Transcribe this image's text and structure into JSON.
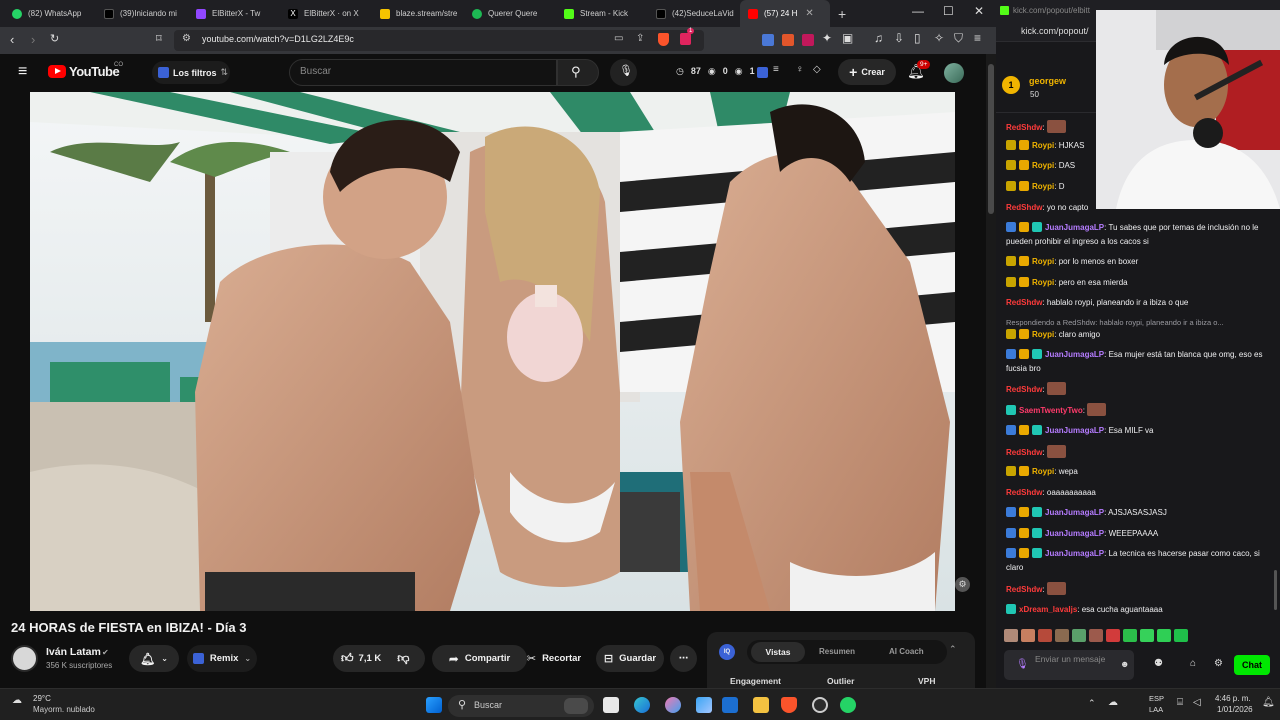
{
  "browser": {
    "tabs": [
      {
        "label": "(82) WhatsApp",
        "color": "#25d366"
      },
      {
        "label": "(39)Iniciando mi",
        "color": "#ffffff"
      },
      {
        "label": "ElBitterX - Tw",
        "color": "#9147ff"
      },
      {
        "label": "ElBitterX · on X",
        "color": "#ffffff"
      },
      {
        "label": "blaze.stream/stre",
        "color": "#f5c400"
      },
      {
        "label": "Querer Quere",
        "color": "#1db954"
      },
      {
        "label": "Stream - Kick",
        "color": "#53fc18"
      },
      {
        "label": "(42)SeduceLaVid",
        "color": "#ffffff"
      },
      {
        "label": "(57) 24 H",
        "color": "#ff0000"
      }
    ],
    "url": "youtube.com/watch?v=D1LG2LZ4E9c",
    "brave_badge": "1"
  },
  "youtube": {
    "logo_text": "YouTube",
    "logo_suffix": "CO",
    "filters_label": "Los filtros",
    "search_placeholder": "Buscar",
    "ext_counts": [
      "87",
      "0",
      "1"
    ],
    "create_label": "Crear",
    "notifications": "9+",
    "video_title": "24 HORAS de FIESTA en IBIZA! - Día 3",
    "channel_name": "Iván Latam",
    "subscribers": "356 K suscriptores",
    "remix_label": "Remix",
    "likes": "7,1 K",
    "share_label": "Compartir",
    "clip_label": "Recortar",
    "save_label": "Guardar",
    "panel_tabs": [
      "Vistas",
      "Resumen",
      "AI Coach"
    ],
    "panel_columns": [
      "Engagement",
      "Outlier",
      "VPH"
    ]
  },
  "chat": {
    "title_url": "kick.com/popout/elbitt",
    "url": "kick.com/popout/",
    "pinned_user": "georgew",
    "pinned_amount": "50",
    "messages": [
      {
        "user": "RedShdw",
        "color": "#ff3b3b",
        "text": "",
        "emote": true,
        "badges": []
      },
      {
        "user": "Roypi",
        "color": "#f0b400",
        "text": "HJKAS",
        "badges": [
          "#c8a400",
          "#e9a800"
        ]
      },
      {
        "user": "Roypi",
        "color": "#f0b400",
        "text": "DAS",
        "badges": [
          "#c8a400",
          "#e9a800"
        ]
      },
      {
        "user": "Roypi",
        "color": "#f0b400",
        "text": "D",
        "badges": [
          "#c8a400",
          "#e9a800"
        ]
      },
      {
        "user": "RedShdw",
        "color": "#ff3b3b",
        "text": "yo no capto",
        "badges": []
      },
      {
        "user": "JuanJumagaLP",
        "color": "#b57cff",
        "text": "Tu sabes que por temas de inclusión no le pueden prohibir el ingreso a los cacos si",
        "badges": [
          "#3b7bd9",
          "#e9a800",
          "#20c7b4"
        ]
      },
      {
        "user": "Roypi",
        "color": "#f0b400",
        "text": "por lo menos en boxer",
        "badges": [
          "#c8a400",
          "#e9a800"
        ]
      },
      {
        "user": "Roypi",
        "color": "#f0b400",
        "text": "pero en esa mierda",
        "badges": [
          "#c8a400",
          "#e9a800"
        ]
      },
      {
        "user": "RedShdw",
        "color": "#ff3b3b",
        "text": "hablalo roypi, planeando ir a ibiza o que",
        "badges": []
      },
      {
        "user": "",
        "color": "#9a9aa0",
        "text": "Respondiendo a RedShdw: hablalo roypi, planeando ir a ibiza o...",
        "badges": [],
        "reply": true
      },
      {
        "user": "Roypi",
        "color": "#f0b400",
        "text": "claro amigo",
        "badges": [
          "#c8a400",
          "#e9a800"
        ]
      },
      {
        "user": "JuanJumagaLP",
        "color": "#b57cff",
        "text": "Esa mujer está tan blanca que omg, eso es fucsia bro",
        "badges": [
          "#3b7bd9",
          "#e9a800",
          "#20c7b4"
        ]
      },
      {
        "user": "RedShdw",
        "color": "#ff3b3b",
        "text": "",
        "emote": true,
        "badges": []
      },
      {
        "user": "SaemTwentyTwo",
        "color": "#ff3b6b",
        "text": "",
        "emote": true,
        "badges": [
          "#20c7b4"
        ]
      },
      {
        "user": "JuanJumagaLP",
        "color": "#b57cff",
        "text": "Esa MILF va",
        "badges": [
          "#3b7bd9",
          "#e9a800",
          "#20c7b4"
        ]
      },
      {
        "user": "RedShdw",
        "color": "#ff3b3b",
        "text": "",
        "emote": true,
        "badges": []
      },
      {
        "user": "Roypi",
        "color": "#f0b400",
        "text": "wepa",
        "badges": [
          "#c8a400",
          "#e9a800"
        ]
      },
      {
        "user": "RedShdw",
        "color": "#ff3b3b",
        "text": "oaaaaaaaaaa",
        "badges": []
      },
      {
        "user": "JuanJumagaLP",
        "color": "#b57cff",
        "text": "AJSJASASJASJ",
        "badges": [
          "#3b7bd9",
          "#e9a800",
          "#20c7b4"
        ]
      },
      {
        "user": "JuanJumagaLP",
        "color": "#b57cff",
        "text": "WEEEPAAAA",
        "badges": [
          "#3b7bd9",
          "#e9a800",
          "#20c7b4"
        ]
      },
      {
        "user": "JuanJumagaLP",
        "color": "#b57cff",
        "text": "La tecnica es hacerse pasar como caco, si claro",
        "badges": [
          "#3b7bd9",
          "#e9a800",
          "#20c7b4"
        ]
      },
      {
        "user": "RedShdw",
        "color": "#ff3b3b",
        "text": "",
        "emote": true,
        "badges": []
      },
      {
        "user": "xDream_lavaIjs",
        "color": "#ff3b3b",
        "text": "esa cucha aguantaaaa",
        "badges": [
          "#20c7b4"
        ]
      }
    ],
    "input_placeholder": "Enviar un mensaje",
    "send_label": "Chat"
  },
  "taskbar": {
    "weather_temp": "29°C",
    "weather_desc": "Mayorm. nublado",
    "search_placeholder": "Buscar",
    "lang": "ESP",
    "lang2": "LAA",
    "time": "4:46 p. m.",
    "date": "1/01/2026"
  }
}
